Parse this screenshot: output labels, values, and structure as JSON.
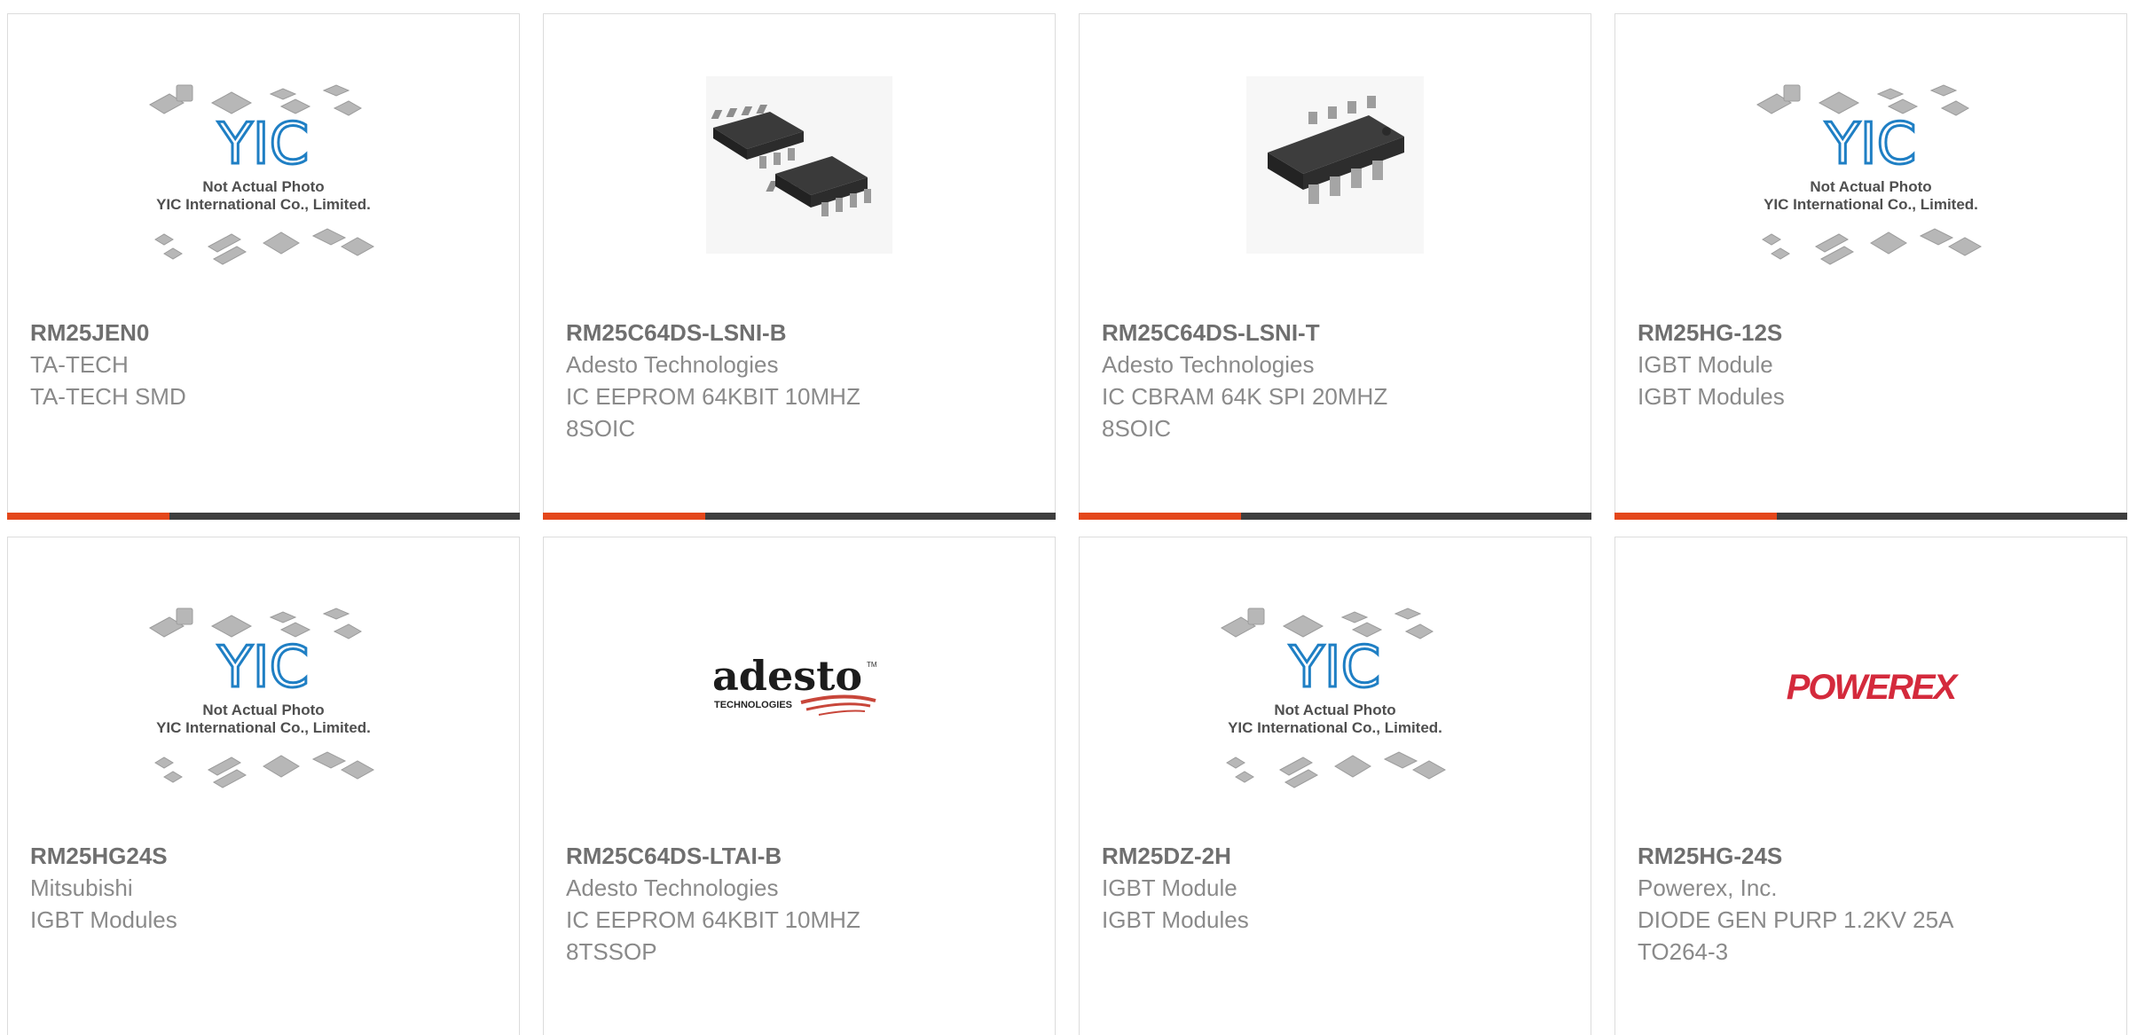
{
  "products": [
    {
      "part_number": "RM25JEN0",
      "manufacturer": "TA-TECH",
      "description_1": "TA-TECH SMD",
      "description_2": "",
      "image": "yic-placeholder-icon"
    },
    {
      "part_number": "RM25C64DS-LSNI-B",
      "manufacturer": "Adesto Technologies",
      "description_1": "IC EEPROM 64KBIT 10MHZ",
      "description_2": "8SOIC",
      "image": "soic8-two-chips-icon"
    },
    {
      "part_number": "RM25C64DS-LSNI-T",
      "manufacturer": "Adesto Technologies",
      "description_1": "IC CBRAM 64K SPI 20MHZ",
      "description_2": "8SOIC",
      "image": "soic8-chip-icon"
    },
    {
      "part_number": "RM25HG-12S",
      "manufacturer": "IGBT Module",
      "description_1": "IGBT Modules",
      "description_2": "",
      "image": "yic-placeholder-icon"
    },
    {
      "part_number": "RM25HG24S",
      "manufacturer": "Mitsubishi",
      "description_1": "IGBT Modules",
      "description_2": "",
      "image": "yic-placeholder-icon"
    },
    {
      "part_number": "RM25C64DS-LTAI-B",
      "manufacturer": "Adesto Technologies",
      "description_1": "IC EEPROM 64KBIT 10MHZ",
      "description_2": "8TSSOP",
      "image": "adesto-logo"
    },
    {
      "part_number": "RM25DZ-2H",
      "manufacturer": "IGBT Module",
      "description_1": "IGBT Modules",
      "description_2": "",
      "image": "yic-placeholder-icon"
    },
    {
      "part_number": "RM25HG-24S",
      "manufacturer": "Powerex, Inc.",
      "description_1": "DIODE GEN PURP 1.2KV 25A",
      "description_2": "TO264-3",
      "image": "powerex-logo"
    }
  ],
  "placeholder": {
    "logo_text": "YIC",
    "caption_1": "Not Actual Photo",
    "caption_2": "YIC International Co., Limited."
  },
  "logos": {
    "adesto": "adesto",
    "adesto_sub": "TECHNOLOGIES",
    "adesto_tm": "TM",
    "powerex": "POWEREX"
  },
  "colors": {
    "accent": "#e4471b",
    "bar": "#3e3e3e",
    "yic_blue": "#1f7fc4",
    "powerex_red": "#d42a3c"
  }
}
